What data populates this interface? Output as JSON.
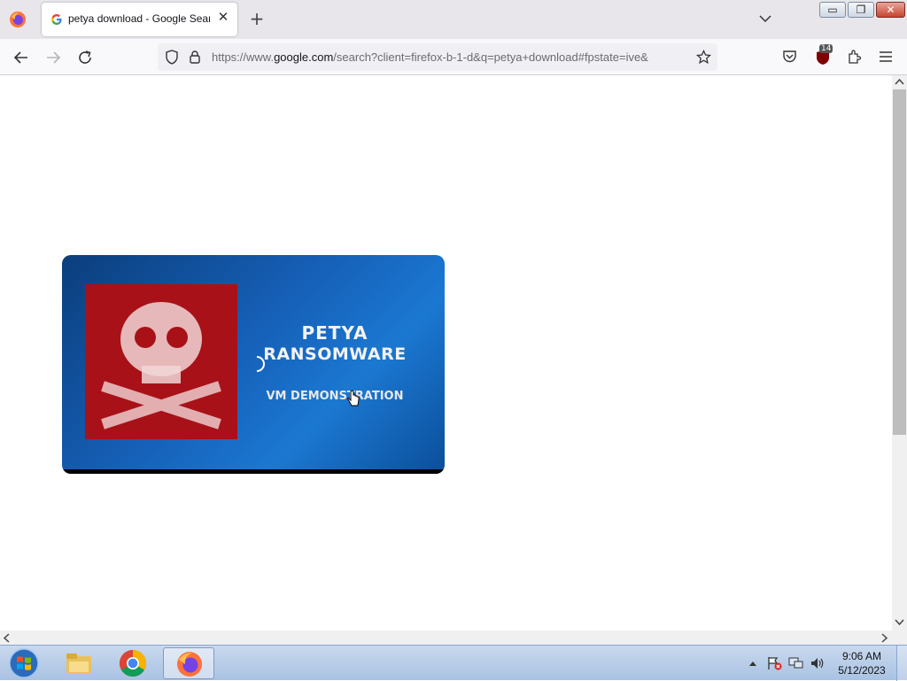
{
  "browser": {
    "tab_title": "petya download - Google Searc",
    "new_tab_label": "+",
    "close_tab_label": "✕",
    "window_controls": {
      "minimize": "▭",
      "maximize": "❐",
      "close": "✕"
    },
    "url": {
      "prefix": "https://www.",
      "domain": "google.com",
      "rest": "/search?client=firefox-b-1-d&q=petya+download#fpstate=ive&"
    },
    "extension_badge_count": "14"
  },
  "content": {
    "video_thumbnail": {
      "line1": "PETYA",
      "line2": "RANSOMWARE",
      "line3": "VM DEMONSTRATION"
    }
  },
  "taskbar": {
    "apps": [
      "file-explorer",
      "chrome",
      "firefox"
    ],
    "active_app": "firefox",
    "clock_time": "9:06 AM",
    "clock_date": "5/12/2023"
  },
  "colors": {
    "accent": "#1660b8",
    "danger": "#a81118",
    "taskbar": "#b9cfeb"
  }
}
